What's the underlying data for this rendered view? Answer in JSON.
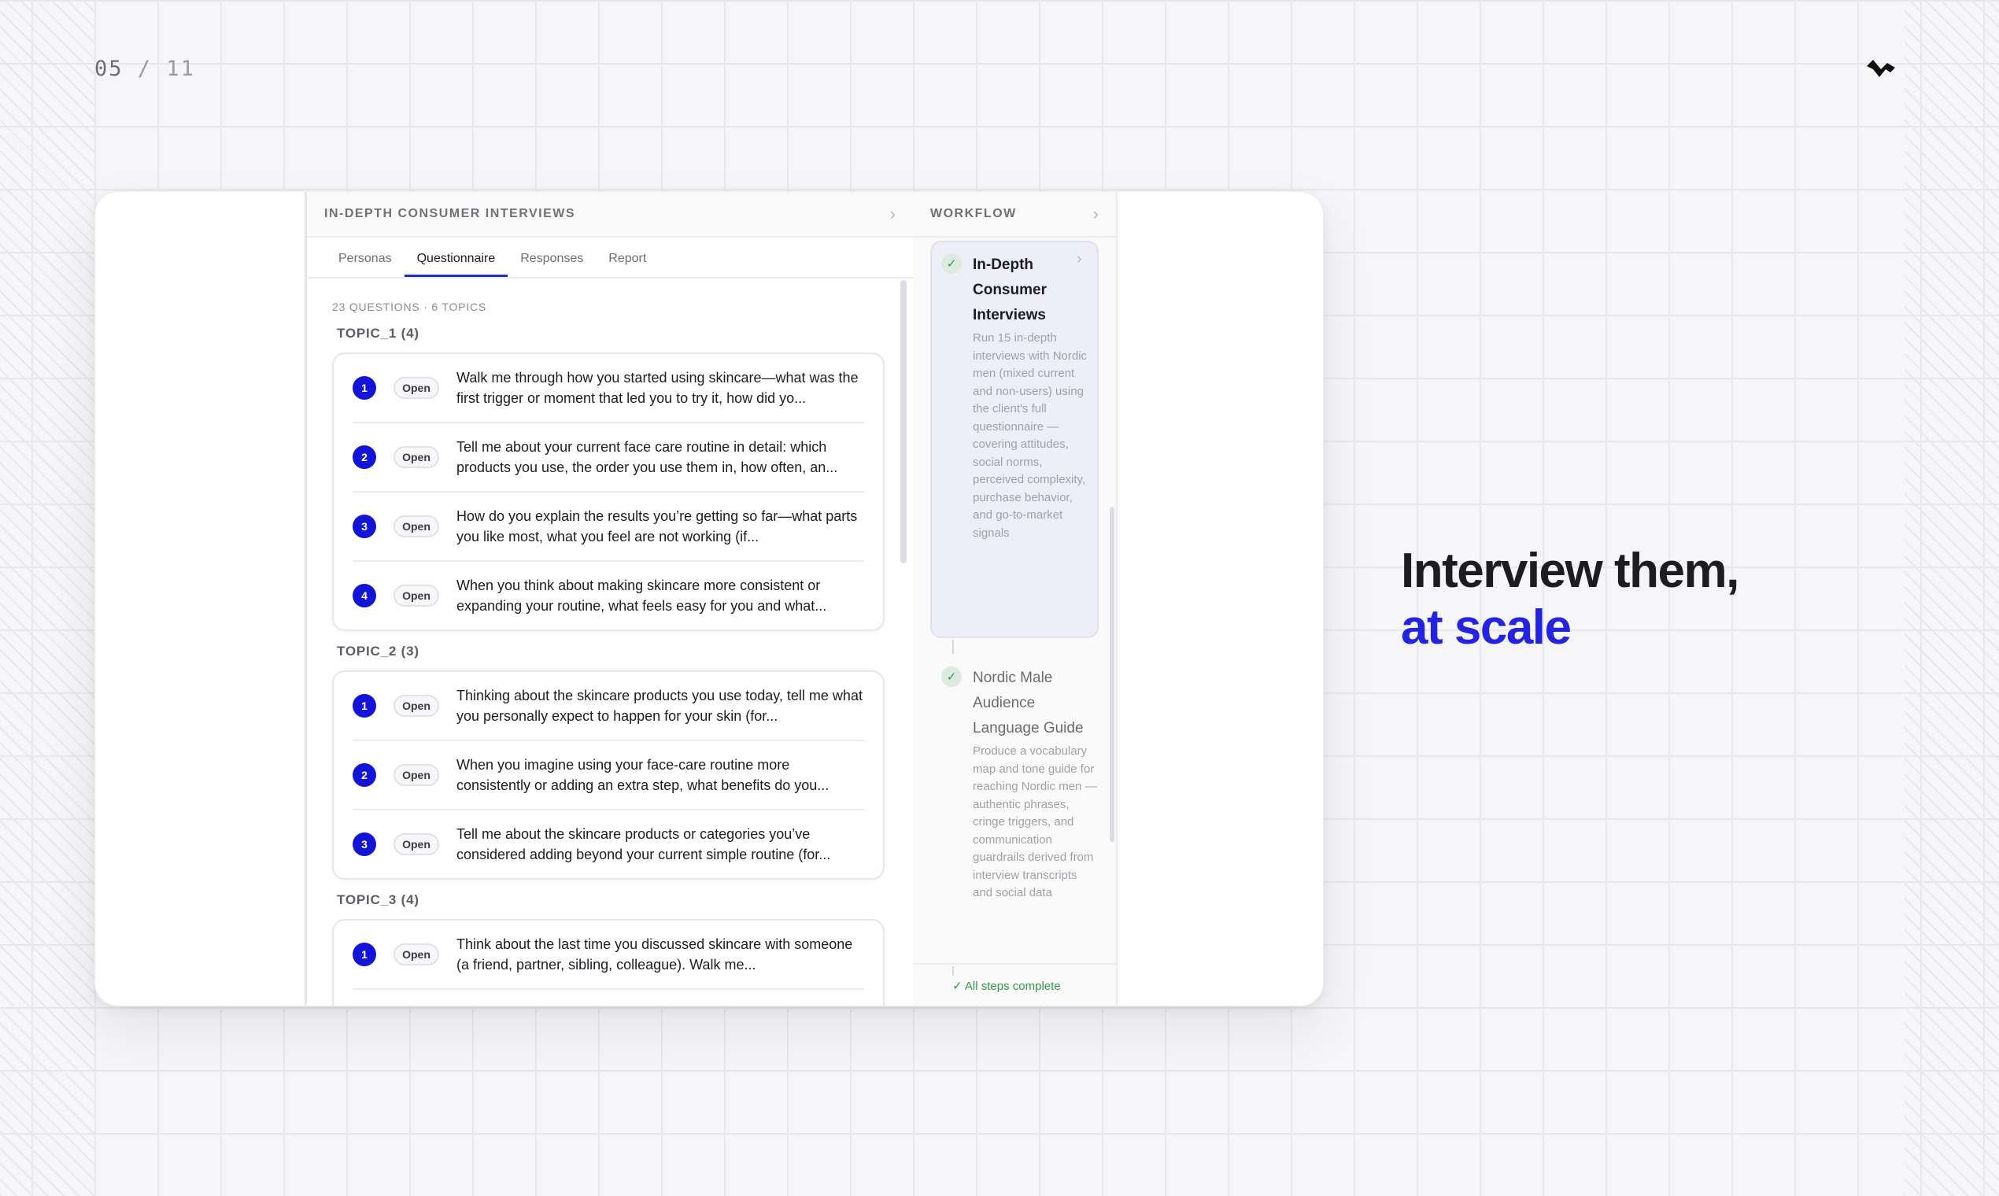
{
  "slide": {
    "current": "05",
    "separator": "/",
    "total": "11"
  },
  "main": {
    "title": "IN-DEPTH CONSUMER INTERVIEWS",
    "tabs": [
      {
        "label": "Personas"
      },
      {
        "label": "Questionnaire",
        "active": true
      },
      {
        "label": "Responses"
      },
      {
        "label": "Report"
      }
    ],
    "meta": "23 QUESTIONS · 6 TOPICS",
    "topics": [
      {
        "label": "TOPIC_1 (4)",
        "questions": [
          {
            "num": "1",
            "badge": "Open",
            "text": "Walk me through how you started using skincare—what was the first trigger or moment that led you to try it, how did yo..."
          },
          {
            "num": "2",
            "badge": "Open",
            "text": "Tell me about your current face care routine in detail: which products you use, the order you use them in, how often, an..."
          },
          {
            "num": "3",
            "badge": "Open",
            "text": "How do you explain the results you’re getting so far—what parts you like most, what you feel are not working (if..."
          },
          {
            "num": "4",
            "badge": "Open",
            "text": "When you think about making skincare more consistent or expanding your routine, what feels easy for you and what..."
          }
        ]
      },
      {
        "label": "TOPIC_2 (3)",
        "questions": [
          {
            "num": "1",
            "badge": "Open",
            "text": "Thinking about the skincare products you use today, tell me what you personally expect to happen for your skin (for..."
          },
          {
            "num": "2",
            "badge": "Open",
            "text": "When you imagine using your face-care routine more consistently or adding an extra step, what benefits do you..."
          },
          {
            "num": "3",
            "badge": "Open",
            "text": "Tell me about the skincare products or categories you’ve considered adding beyond your current simple routine (for..."
          }
        ]
      },
      {
        "label": "TOPIC_3 (4)",
        "questions": [
          {
            "num": "1",
            "badge": "Open",
            "text": "Think about the last time you discussed skincare with someone (a friend, partner, sibling, colleague). Walk me..."
          }
        ]
      }
    ]
  },
  "workflow": {
    "title": "WORKFLOW",
    "steps": [
      {
        "title": "In-Depth Consumer Interviews",
        "description": "Run 15 in-depth interviews with Nordic men (mixed current and non-users) using the client's full questionnaire — covering attitudes, social norms, perceived complexity, purchase behavior, and go-to-market signals",
        "complete": true
      },
      {
        "title": "Nordic Male Audience Language Guide",
        "description": "Produce a vocabulary map and tone guide for reaching Nordic men — authentic phrases, cringe triggers, and communication guardrails derived from interview transcripts and social data",
        "complete": true
      }
    ],
    "footer": "All steps complete"
  },
  "headline": {
    "line1": "Interview them,",
    "line2": "at scale"
  },
  "colors": {
    "accent": "#2424e0",
    "badge_blue": "#1414d6",
    "success": "#2f9a4a"
  }
}
